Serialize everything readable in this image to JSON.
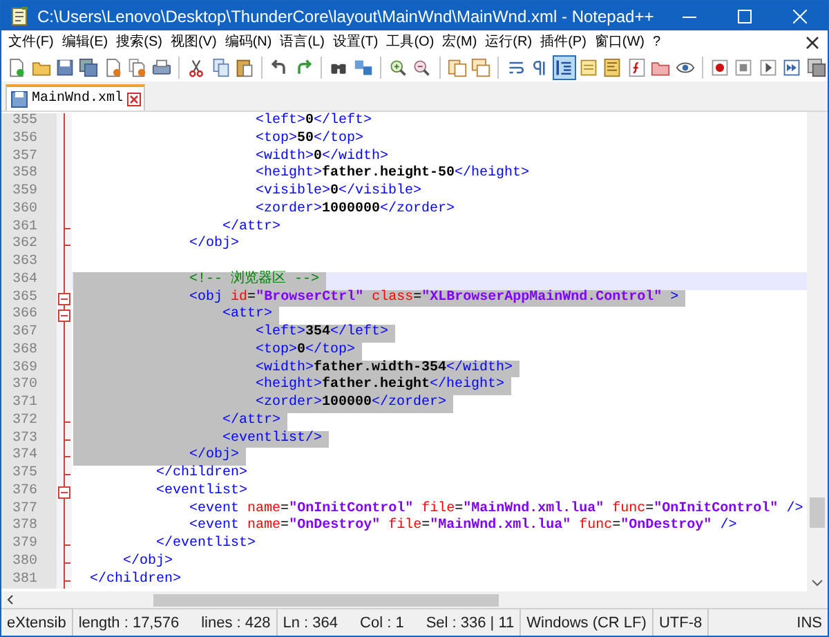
{
  "window": {
    "title": "C:\\Users\\Lenovo\\Desktop\\ThunderCore\\layout\\MainWnd\\MainWnd.xml - Notepad++"
  },
  "menu": [
    "文件(F)",
    "编辑(E)",
    "搜索(S)",
    "视图(V)",
    "编码(N)",
    "语言(L)",
    "设置(T)",
    "工具(O)",
    "宏(M)",
    "运行(R)",
    "插件(P)",
    "窗口(W)",
    "?"
  ],
  "toolbar": [
    {
      "buttons": [
        {
          "kind": "new",
          "on": false
        },
        {
          "kind": "open",
          "on": false
        },
        {
          "kind": "save",
          "on": false
        },
        {
          "kind": "saveall",
          "on": false
        },
        {
          "kind": "close",
          "on": false
        },
        {
          "kind": "closeall",
          "on": false
        },
        {
          "kind": "print",
          "on": false
        }
      ]
    },
    {
      "buttons": [
        {
          "kind": "cut",
          "on": false
        },
        {
          "kind": "copy",
          "on": false
        },
        {
          "kind": "paste",
          "on": false
        }
      ]
    },
    {
      "buttons": [
        {
          "kind": "undo",
          "on": false
        },
        {
          "kind": "redo",
          "on": false
        }
      ]
    },
    {
      "buttons": [
        {
          "kind": "find",
          "on": false
        },
        {
          "kind": "replace",
          "on": false
        }
      ]
    },
    {
      "buttons": [
        {
          "kind": "zoomin",
          "on": false
        },
        {
          "kind": "zoomout",
          "on": false
        }
      ]
    },
    {
      "buttons": [
        {
          "kind": "syncv",
          "on": false
        },
        {
          "kind": "synch",
          "on": false
        }
      ]
    },
    {
      "buttons": [
        {
          "kind": "wrap",
          "on": false
        },
        {
          "kind": "allchars",
          "on": false
        },
        {
          "kind": "guide",
          "on": true
        },
        {
          "kind": "udl",
          "on": false
        },
        {
          "kind": "docmap",
          "on": false
        },
        {
          "kind": "funclist",
          "on": false
        },
        {
          "kind": "workspace",
          "on": false
        },
        {
          "kind": "monitor",
          "on": false
        }
      ]
    },
    {
      "buttons": [
        {
          "kind": "record",
          "on": false
        },
        {
          "kind": "stop",
          "on": false
        },
        {
          "kind": "play",
          "on": false
        },
        {
          "kind": "playmulti",
          "on": false
        },
        {
          "kind": "savemacro",
          "on": false
        }
      ]
    }
  ],
  "tabs": [
    {
      "label": "MainWnd.xml",
      "selected": true
    }
  ],
  "lines": [
    {
      "number": "355",
      "fold_start": false,
      "fold_end": false,
      "selected": false,
      "current": false,
      "tokens": [
        {
          "kind": "tag",
          "text": "                      <left>"
        },
        {
          "kind": "text",
          "text": "0"
        },
        {
          "kind": "tag",
          "text": "</left>"
        }
      ]
    },
    {
      "number": "356",
      "fold_start": false,
      "fold_end": false,
      "selected": false,
      "current": false,
      "tokens": [
        {
          "kind": "tag",
          "text": "                      <top>"
        },
        {
          "kind": "text",
          "text": "50"
        },
        {
          "kind": "tag",
          "text": "</top>"
        }
      ]
    },
    {
      "number": "357",
      "fold_start": false,
      "fold_end": false,
      "selected": false,
      "current": false,
      "tokens": [
        {
          "kind": "tag",
          "text": "                      <width>"
        },
        {
          "kind": "text",
          "text": "0"
        },
        {
          "kind": "tag",
          "text": "</width>"
        }
      ]
    },
    {
      "number": "358",
      "fold_start": false,
      "fold_end": false,
      "selected": false,
      "current": false,
      "tokens": [
        {
          "kind": "tag",
          "text": "                      <height>"
        },
        {
          "kind": "text",
          "text": "father.height-50"
        },
        {
          "kind": "tag",
          "text": "</height>"
        }
      ]
    },
    {
      "number": "359",
      "fold_start": false,
      "fold_end": false,
      "selected": false,
      "current": false,
      "tokens": [
        {
          "kind": "tag",
          "text": "                      <visible>"
        },
        {
          "kind": "text",
          "text": "0"
        },
        {
          "kind": "tag",
          "text": "</visible>"
        }
      ]
    },
    {
      "number": "360",
      "fold_start": false,
      "fold_end": false,
      "selected": false,
      "current": false,
      "tokens": [
        {
          "kind": "tag",
          "text": "                      <zorder>"
        },
        {
          "kind": "text",
          "text": "1000000"
        },
        {
          "kind": "tag",
          "text": "</zorder>"
        }
      ]
    },
    {
      "number": "361",
      "fold_start": false,
      "fold_end": true,
      "selected": false,
      "current": false,
      "tokens": [
        {
          "kind": "tag",
          "text": "                  </attr>"
        }
      ]
    },
    {
      "number": "362",
      "fold_start": false,
      "fold_end": true,
      "selected": false,
      "current": false,
      "tokens": [
        {
          "kind": "tag",
          "text": "              </obj>"
        }
      ]
    },
    {
      "number": "363",
      "fold_start": false,
      "fold_end": false,
      "selected": false,
      "current": false
    },
    {
      "number": "364",
      "fold_start": false,
      "fold_end": false,
      "selected": true,
      "current": true,
      "tokens": [
        {
          "kind": "comment",
          "text": "              <!-- 浏览器区 -->"
        }
      ]
    },
    {
      "number": "365",
      "fold_start": true,
      "fold_end": false,
      "selected": true,
      "current": false,
      "tokens": [
        {
          "kind": "tag",
          "text": "              <obj"
        },
        {
          "kind": "attr",
          "text": " id"
        },
        {
          "kind": "plain",
          "text": "="
        },
        {
          "kind": "value",
          "text": "\"BrowserCtrl\""
        },
        {
          "kind": "attr",
          "text": " class"
        },
        {
          "kind": "plain",
          "text": "="
        },
        {
          "kind": "value",
          "text": "\"XLBrowserAppMainWnd.Control\""
        },
        {
          "kind": "tag",
          "text": " >"
        }
      ]
    },
    {
      "number": "366",
      "fold_start": true,
      "fold_end": false,
      "selected": true,
      "current": false,
      "tokens": [
        {
          "kind": "tag",
          "text": "                  <attr>"
        }
      ]
    },
    {
      "number": "367",
      "fold_start": false,
      "fold_end": false,
      "selected": true,
      "current": false,
      "tokens": [
        {
          "kind": "tag",
          "text": "                      <left>"
        },
        {
          "kind": "text",
          "text": "354"
        },
        {
          "kind": "tag",
          "text": "</left>"
        }
      ]
    },
    {
      "number": "368",
      "fold_start": false,
      "fold_end": false,
      "selected": true,
      "current": false,
      "tokens": [
        {
          "kind": "tag",
          "text": "                      <top>"
        },
        {
          "kind": "text",
          "text": "0"
        },
        {
          "kind": "tag",
          "text": "</top>"
        }
      ]
    },
    {
      "number": "369",
      "fold_start": false,
      "fold_end": false,
      "selected": true,
      "current": false,
      "tokens": [
        {
          "kind": "tag",
          "text": "                      <width>"
        },
        {
          "kind": "text",
          "text": "father.width-354"
        },
        {
          "kind": "tag",
          "text": "</width>"
        }
      ]
    },
    {
      "number": "370",
      "fold_start": false,
      "fold_end": false,
      "selected": true,
      "current": false,
      "tokens": [
        {
          "kind": "tag",
          "text": "                      <height>"
        },
        {
          "kind": "text",
          "text": "father.height"
        },
        {
          "kind": "tag",
          "text": "</height>"
        }
      ]
    },
    {
      "number": "371",
      "fold_start": false,
      "fold_end": false,
      "selected": true,
      "current": false,
      "tokens": [
        {
          "kind": "tag",
          "text": "                      <zorder>"
        },
        {
          "kind": "text",
          "text": "100000"
        },
        {
          "kind": "tag",
          "text": "</zorder>"
        }
      ]
    },
    {
      "number": "372",
      "fold_start": false,
      "fold_end": true,
      "selected": true,
      "current": false,
      "tokens": [
        {
          "kind": "tag",
          "text": "                  </attr>"
        }
      ]
    },
    {
      "number": "373",
      "fold_start": false,
      "fold_end": true,
      "selected": true,
      "current": false,
      "tokens": [
        {
          "kind": "tag",
          "text": "                  <eventlist/>"
        }
      ]
    },
    {
      "number": "374",
      "fold_start": false,
      "fold_end": true,
      "selected": true,
      "current": false,
      "tokens": [
        {
          "kind": "tag",
          "text": "              </obj>"
        }
      ]
    },
    {
      "number": "375",
      "fold_start": false,
      "fold_end": true,
      "selected": false,
      "current": false,
      "tokens": [
        {
          "kind": "tag",
          "text": "          </children>"
        }
      ]
    },
    {
      "number": "376",
      "fold_start": true,
      "fold_end": false,
      "selected": false,
      "current": false,
      "tokens": [
        {
          "kind": "tag",
          "text": "          <eventlist>"
        }
      ]
    },
    {
      "number": "377",
      "fold_start": false,
      "fold_end": false,
      "selected": false,
      "current": false,
      "tokens": [
        {
          "kind": "tag",
          "text": "              <event"
        },
        {
          "kind": "attr",
          "text": " name"
        },
        {
          "kind": "plain",
          "text": "="
        },
        {
          "kind": "value",
          "text": "\"OnInitControl\""
        },
        {
          "kind": "attr",
          "text": " file"
        },
        {
          "kind": "plain",
          "text": "="
        },
        {
          "kind": "value",
          "text": "\"MainWnd.xml.lua\""
        },
        {
          "kind": "attr",
          "text": " func"
        },
        {
          "kind": "plain",
          "text": "="
        },
        {
          "kind": "value",
          "text": "\"OnInitControl\""
        },
        {
          "kind": "tag",
          "text": " />"
        }
      ]
    },
    {
      "number": "378",
      "fold_start": false,
      "fold_end": false,
      "selected": false,
      "current": false,
      "tokens": [
        {
          "kind": "tag",
          "text": "              <event"
        },
        {
          "kind": "attr",
          "text": " name"
        },
        {
          "kind": "plain",
          "text": "="
        },
        {
          "kind": "value",
          "text": "\"OnDestroy\""
        },
        {
          "kind": "attr",
          "text": " file"
        },
        {
          "kind": "plain",
          "text": "="
        },
        {
          "kind": "value",
          "text": "\"MainWnd.xml.lua\""
        },
        {
          "kind": "attr",
          "text": " func"
        },
        {
          "kind": "plain",
          "text": "="
        },
        {
          "kind": "value",
          "text": "\"OnDestroy\""
        },
        {
          "kind": "tag",
          "text": " />"
        }
      ]
    },
    {
      "number": "379",
      "fold_start": false,
      "fold_end": true,
      "selected": false,
      "current": false,
      "tokens": [
        {
          "kind": "tag",
          "text": "          </eventlist>"
        }
      ]
    },
    {
      "number": "380",
      "fold_start": false,
      "fold_end": true,
      "selected": false,
      "current": false,
      "tokens": [
        {
          "kind": "tag",
          "text": "      </obj>"
        }
      ]
    },
    {
      "number": "381",
      "fold_start": false,
      "fold_end": true,
      "selected": false,
      "current": false,
      "tokens": [
        {
          "kind": "tag",
          "text": "  </children>"
        }
      ]
    }
  ],
  "status_bar": [
    {
      "items": [
        "eXtensib"
      ]
    },
    {
      "items": [
        "length : 17,576",
        "lines : 428"
      ]
    },
    {
      "items": [
        "Ln : 364",
        "Col : 1",
        "Sel : 336 | 11"
      ]
    },
    {
      "items": [
        "Windows (CR LF)"
      ]
    },
    {
      "items": [
        "UTF-8"
      ]
    },
    {
      "items": [
        "INS"
      ]
    }
  ]
}
